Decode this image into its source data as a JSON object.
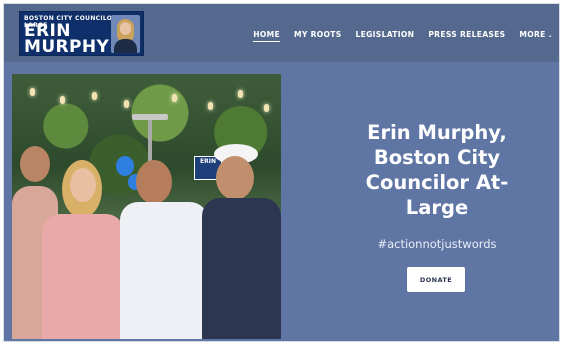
{
  "logo": {
    "top_text": "BOSTON CITY COUNCILOR AT-LARGE",
    "name_line1": "ERIN",
    "name_line2": "MURPHY"
  },
  "nav": {
    "items": [
      {
        "label": "HOME",
        "active": true
      },
      {
        "label": "MY ROOTS",
        "active": false
      },
      {
        "label": "LEGISLATION",
        "active": false
      },
      {
        "label": "PRESS RELEASES",
        "active": false
      },
      {
        "label": "MORE",
        "active": false
      }
    ],
    "more_icon": "chevron-down-icon"
  },
  "hero": {
    "title": "Erin Murphy, Boston City Councilor At-Large",
    "hashtag": "#actionnotjustwords",
    "donate_label": "DONATE",
    "photo_sign_text": "ERIN"
  },
  "colors": {
    "page_background": "#5f76a5",
    "header_background": "#55698f",
    "logo_background": "#0f2f6b",
    "button_background": "#ffffff",
    "text": "#ffffff"
  }
}
